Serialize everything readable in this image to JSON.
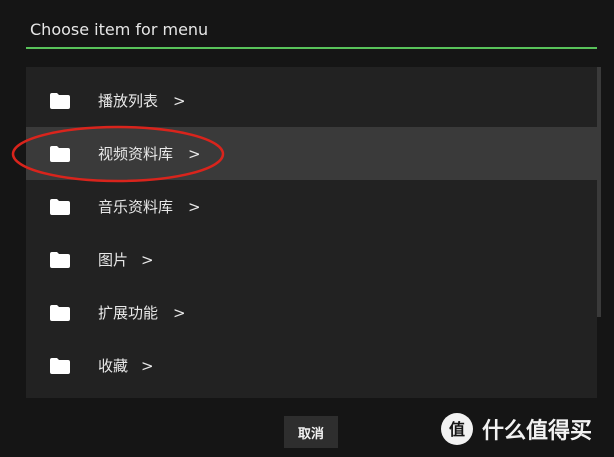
{
  "dialog": {
    "title": "Choose item for menu",
    "cancel_label": "取消"
  },
  "items": [
    {
      "label": "播放列表",
      "arrow": ">",
      "highlighted": false
    },
    {
      "label": "视频资料库",
      "arrow": ">",
      "highlighted": true
    },
    {
      "label": "音乐资料库",
      "arrow": ">",
      "highlighted": false
    },
    {
      "label": "图片",
      "arrow": ">",
      "highlighted": false
    },
    {
      "label": "扩展功能",
      "arrow": ">",
      "highlighted": false
    },
    {
      "label": "收藏",
      "arrow": ">",
      "highlighted": false
    }
  ],
  "watermark": {
    "text": "什么值得买",
    "logo_glyph": "值"
  },
  "colors": {
    "accent": "#58c25a",
    "annotation": "#d9241c",
    "highlight_row": "#3a3a3a"
  }
}
